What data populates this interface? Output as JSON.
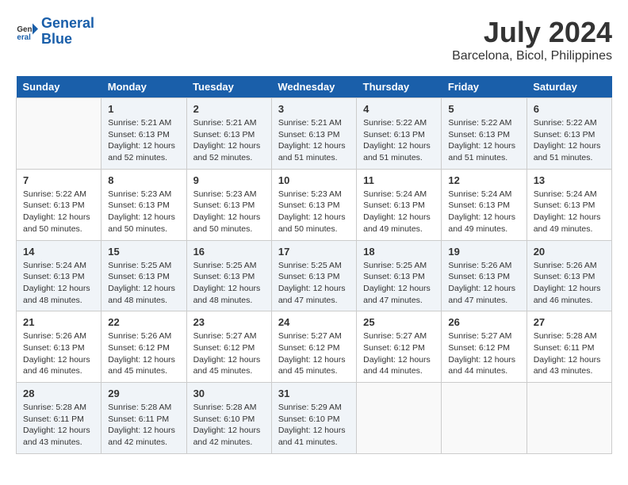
{
  "header": {
    "logo_line1": "General",
    "logo_line2": "Blue",
    "title": "July 2024",
    "subtitle": "Barcelona, Bicol, Philippines"
  },
  "calendar": {
    "days_of_week": [
      "Sunday",
      "Monday",
      "Tuesday",
      "Wednesday",
      "Thursday",
      "Friday",
      "Saturday"
    ],
    "weeks": [
      [
        {
          "day": "",
          "info": ""
        },
        {
          "day": "1",
          "info": "Sunrise: 5:21 AM\nSunset: 6:13 PM\nDaylight: 12 hours\nand 52 minutes."
        },
        {
          "day": "2",
          "info": "Sunrise: 5:21 AM\nSunset: 6:13 PM\nDaylight: 12 hours\nand 52 minutes."
        },
        {
          "day": "3",
          "info": "Sunrise: 5:21 AM\nSunset: 6:13 PM\nDaylight: 12 hours\nand 51 minutes."
        },
        {
          "day": "4",
          "info": "Sunrise: 5:22 AM\nSunset: 6:13 PM\nDaylight: 12 hours\nand 51 minutes."
        },
        {
          "day": "5",
          "info": "Sunrise: 5:22 AM\nSunset: 6:13 PM\nDaylight: 12 hours\nand 51 minutes."
        },
        {
          "day": "6",
          "info": "Sunrise: 5:22 AM\nSunset: 6:13 PM\nDaylight: 12 hours\nand 51 minutes."
        }
      ],
      [
        {
          "day": "7",
          "info": "Sunrise: 5:22 AM\nSunset: 6:13 PM\nDaylight: 12 hours\nand 50 minutes."
        },
        {
          "day": "8",
          "info": "Sunrise: 5:23 AM\nSunset: 6:13 PM\nDaylight: 12 hours\nand 50 minutes."
        },
        {
          "day": "9",
          "info": "Sunrise: 5:23 AM\nSunset: 6:13 PM\nDaylight: 12 hours\nand 50 minutes."
        },
        {
          "day": "10",
          "info": "Sunrise: 5:23 AM\nSunset: 6:13 PM\nDaylight: 12 hours\nand 50 minutes."
        },
        {
          "day": "11",
          "info": "Sunrise: 5:24 AM\nSunset: 6:13 PM\nDaylight: 12 hours\nand 49 minutes."
        },
        {
          "day": "12",
          "info": "Sunrise: 5:24 AM\nSunset: 6:13 PM\nDaylight: 12 hours\nand 49 minutes."
        },
        {
          "day": "13",
          "info": "Sunrise: 5:24 AM\nSunset: 6:13 PM\nDaylight: 12 hours\nand 49 minutes."
        }
      ],
      [
        {
          "day": "14",
          "info": "Sunrise: 5:24 AM\nSunset: 6:13 PM\nDaylight: 12 hours\nand 48 minutes."
        },
        {
          "day": "15",
          "info": "Sunrise: 5:25 AM\nSunset: 6:13 PM\nDaylight: 12 hours\nand 48 minutes."
        },
        {
          "day": "16",
          "info": "Sunrise: 5:25 AM\nSunset: 6:13 PM\nDaylight: 12 hours\nand 48 minutes."
        },
        {
          "day": "17",
          "info": "Sunrise: 5:25 AM\nSunset: 6:13 PM\nDaylight: 12 hours\nand 47 minutes."
        },
        {
          "day": "18",
          "info": "Sunrise: 5:25 AM\nSunset: 6:13 PM\nDaylight: 12 hours\nand 47 minutes."
        },
        {
          "day": "19",
          "info": "Sunrise: 5:26 AM\nSunset: 6:13 PM\nDaylight: 12 hours\nand 47 minutes."
        },
        {
          "day": "20",
          "info": "Sunrise: 5:26 AM\nSunset: 6:13 PM\nDaylight: 12 hours\nand 46 minutes."
        }
      ],
      [
        {
          "day": "21",
          "info": "Sunrise: 5:26 AM\nSunset: 6:13 PM\nDaylight: 12 hours\nand 46 minutes."
        },
        {
          "day": "22",
          "info": "Sunrise: 5:26 AM\nSunset: 6:12 PM\nDaylight: 12 hours\nand 45 minutes."
        },
        {
          "day": "23",
          "info": "Sunrise: 5:27 AM\nSunset: 6:12 PM\nDaylight: 12 hours\nand 45 minutes."
        },
        {
          "day": "24",
          "info": "Sunrise: 5:27 AM\nSunset: 6:12 PM\nDaylight: 12 hours\nand 45 minutes."
        },
        {
          "day": "25",
          "info": "Sunrise: 5:27 AM\nSunset: 6:12 PM\nDaylight: 12 hours\nand 44 minutes."
        },
        {
          "day": "26",
          "info": "Sunrise: 5:27 AM\nSunset: 6:12 PM\nDaylight: 12 hours\nand 44 minutes."
        },
        {
          "day": "27",
          "info": "Sunrise: 5:28 AM\nSunset: 6:11 PM\nDaylight: 12 hours\nand 43 minutes."
        }
      ],
      [
        {
          "day": "28",
          "info": "Sunrise: 5:28 AM\nSunset: 6:11 PM\nDaylight: 12 hours\nand 43 minutes."
        },
        {
          "day": "29",
          "info": "Sunrise: 5:28 AM\nSunset: 6:11 PM\nDaylight: 12 hours\nand 42 minutes."
        },
        {
          "day": "30",
          "info": "Sunrise: 5:28 AM\nSunset: 6:10 PM\nDaylight: 12 hours\nand 42 minutes."
        },
        {
          "day": "31",
          "info": "Sunrise: 5:29 AM\nSunset: 6:10 PM\nDaylight: 12 hours\nand 41 minutes."
        },
        {
          "day": "",
          "info": ""
        },
        {
          "day": "",
          "info": ""
        },
        {
          "day": "",
          "info": ""
        }
      ]
    ]
  }
}
